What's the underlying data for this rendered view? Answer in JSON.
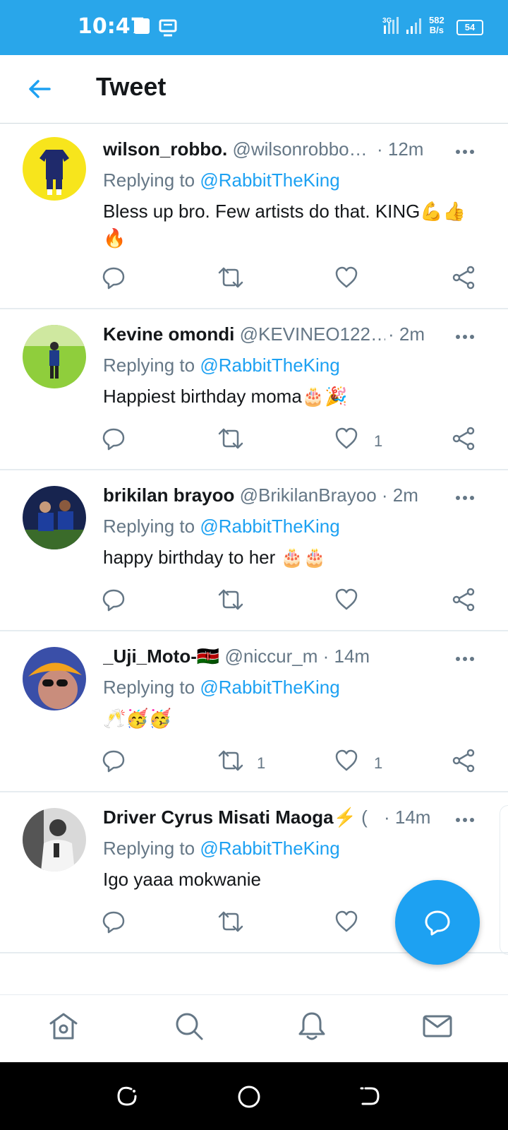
{
  "status_bar": {
    "time": "10:47",
    "network_type": "3G",
    "speed_value": "582",
    "speed_unit": "B/s",
    "battery": "54"
  },
  "header": {
    "title": "Tweet"
  },
  "tweets": [
    {
      "name": "wilson_robbo.",
      "handle": "@wilsonrobbo…",
      "time": "· 12m",
      "replying_label": "Replying to",
      "replying_to": "@RabbitTheKing",
      "text": "Bless up bro. Few artists do that. KING💪👍🔥",
      "retweets": "",
      "likes": ""
    },
    {
      "name": "Kevine omondi",
      "handle": "@KEVINEO122…",
      "time": "· 2m",
      "replying_label": "Replying to",
      "replying_to": "@RabbitTheKing",
      "text": "Happiest birthday moma🎂🎉",
      "retweets": "",
      "likes": "1"
    },
    {
      "name": "brikilan brayoo",
      "handle": "@BrikilanBrayoo",
      "time": "· 2m",
      "replying_label": "Replying to",
      "replying_to": "@RabbitTheKing",
      "text": "happy birthday to her 🎂🎂",
      "retweets": "",
      "likes": ""
    },
    {
      "name": "_Uji_Moto-🇰🇪",
      "handle": "@niccur_m",
      "time": "· 14m",
      "replying_label": "Replying to",
      "replying_to": "@RabbitTheKing",
      "text": "🥂🥳🥳",
      "retweets": "1",
      "likes": "1"
    },
    {
      "name": "Driver Cyrus Misati Maoga⚡",
      "handle": "(",
      "time": "· 14m",
      "replying_label": "Replying to",
      "replying_to": "@RabbitTheKing",
      "text": "Igo yaaa mokwanie",
      "retweets": "",
      "likes": ""
    }
  ],
  "colors": {
    "status_bar": "#29a6ea",
    "accent": "#1da1f2",
    "secondary_text": "#657786",
    "divider": "#e6ecf0"
  },
  "icons": {
    "back": "arrow-left-icon",
    "more": "more-horizontal-icon",
    "reply": "comment-icon",
    "retweet": "retweet-icon",
    "like": "heart-icon",
    "share": "share-icon",
    "compose": "compose-reply-icon",
    "nav": [
      "home-icon",
      "search-icon",
      "notifications-icon",
      "messages-icon"
    ],
    "system": [
      "recents-icon",
      "home-circle-icon",
      "back-icon"
    ]
  }
}
